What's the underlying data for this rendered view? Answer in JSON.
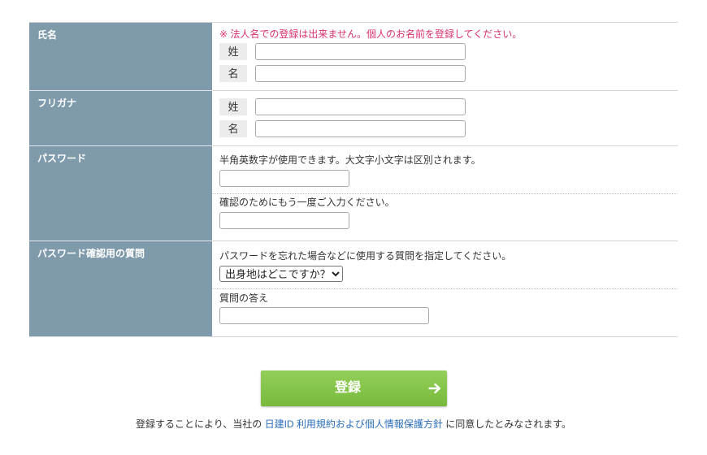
{
  "form": {
    "name": {
      "label": "氏名",
      "note": "※ 法人名での登録は出来ません。個人のお名前を登録してください。",
      "last_label": "姓",
      "last_value": "",
      "first_label": "名",
      "first_value": ""
    },
    "kana": {
      "label": "フリガナ",
      "last_label": "姓",
      "last_value": "",
      "first_label": "名",
      "first_value": ""
    },
    "password": {
      "label": "パスワード",
      "hint": "半角英数字が使用できます。大文字小文字は区別されます。",
      "value": "",
      "confirm_hint": "確認のためにもう一度ご入力ください。",
      "confirm_value": ""
    },
    "security_question": {
      "label": "パスワード確認用の質問",
      "hint": "パスワードを忘れた場合などに使用する質問を指定してください。",
      "selected": "出身地はどこですか？",
      "answer_label": "質問の答え",
      "answer_value": ""
    }
  },
  "submit": {
    "label": "登録",
    "icon": "arrow-right-icon"
  },
  "footer": {
    "prefix": "登録することにより、当社の ",
    "link": "日建ID 利用規約および個人情報保護方針",
    "suffix": " に同意したとみなされます。"
  },
  "colors": {
    "label_bg": "#7f9bab",
    "note": "#d9306e",
    "link": "#2a6ebb",
    "button_top": "#93cf5a",
    "button_bottom": "#78ba3c"
  }
}
